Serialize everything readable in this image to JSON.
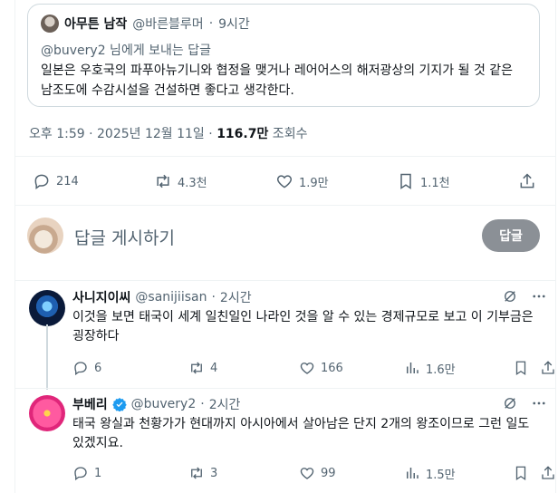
{
  "quoted": {
    "author_name": "아무튼 남작",
    "handle": "@바른블루머",
    "time": "9시간",
    "reply_to_handle": "@buvery2",
    "reply_to_suffix": " 님에게 보내는 답글",
    "text": "일본은 우호국의 파푸아뉴기니와 협정을 맺거나 레어어스의 해저광상의 기지가 될 것 같은 남조도에 수감시설을 건설하면 좋다고 생각한다."
  },
  "meta": {
    "time": "오후 1:59",
    "sep1": " · ",
    "date": "2025년 12월 11일",
    "sep2": " · ",
    "views_count": "116.7만",
    "views_label": " 조회수"
  },
  "actions": {
    "reply": "214",
    "retweet": "4.3천",
    "like": "1.9만",
    "bookmark": "1.1천"
  },
  "compose": {
    "placeholder": "답글 게시하기",
    "button": "답글"
  },
  "replies": [
    {
      "author_name": "사니지이씨",
      "handle": "@sanijiisan",
      "time": "2시간",
      "text": "이것을 보면 태국이 세계 일친일인 나라인 것을 알 수 있는 경제규모로 보고 이 기부금은 굉장하다",
      "reply": "6",
      "retweet": "4",
      "like": "166",
      "views": "1.6만"
    },
    {
      "author_name": "부베리",
      "handle": "@buvery2",
      "time": "2시간",
      "text": "태국 왕실과 천황가가 현대까지 아시아에서 살아남은 단지 2개의 왕조이므로 그런 일도 있겠지요.",
      "reply": "1",
      "retweet": "3",
      "like": "99",
      "views": "1.5만"
    }
  ],
  "colors": {
    "accent": "#1d9bf0",
    "muted": "#536471",
    "border": "#cfd9de"
  }
}
